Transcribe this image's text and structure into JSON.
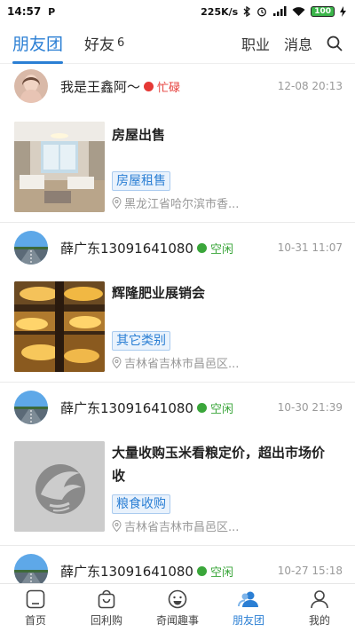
{
  "status_bar": {
    "time": "14:57",
    "app_icon": "P",
    "speed": "225K/s",
    "battery": "100"
  },
  "header": {
    "tabs": [
      {
        "label": "朋友团",
        "count": ""
      },
      {
        "label": "好友",
        "count": "6"
      }
    ],
    "right": {
      "career_label": "职业",
      "messages_label": "消息"
    }
  },
  "posts": [
    {
      "user": "我是王鑫阿～",
      "status": "忙碌",
      "status_color": "#e53935",
      "time": "12-08 20:13",
      "title": "房屋出售",
      "title2": "",
      "tag": "房屋租售",
      "location": "黑龙江省哈尔滨市香..."
    },
    {
      "user": "薛广东13091641080",
      "status": "空闲",
      "status_color": "#3aa63a",
      "time": "10-31 11:07",
      "title": "辉隆肥业展销会",
      "title2": "",
      "tag": "其它类别",
      "location": "吉林省吉林市昌邑区..."
    },
    {
      "user": "薛广东13091641080",
      "status": "空闲",
      "status_color": "#3aa63a",
      "time": "10-30 21:39",
      "title": "大量收购玉米看粮定价，超出市场价",
      "title2": "收",
      "tag": "粮食收购",
      "location": "吉林省吉林市昌邑区..."
    },
    {
      "user": "薛广东13091641080",
      "status": "空闲",
      "status_color": "#3aa63a",
      "time": "10-27 15:18"
    }
  ],
  "bottom_nav": [
    {
      "label": "首页",
      "icon": "home-icon"
    },
    {
      "label": "回利购",
      "icon": "shopping-bag-icon"
    },
    {
      "label": "奇闻趣事",
      "icon": "smile-icon"
    },
    {
      "label": "朋友团",
      "icon": "friends-icon"
    },
    {
      "label": "我的",
      "icon": "person-icon"
    }
  ],
  "colors": {
    "accent": "#2b7fd4",
    "busy": "#e53935",
    "free": "#3aa63a"
  }
}
